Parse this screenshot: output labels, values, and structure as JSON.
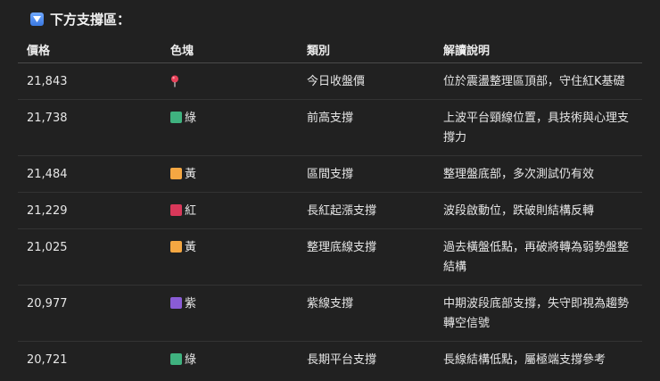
{
  "heading": {
    "icon": "down-arrow-button-icon",
    "text": "下方支撐區："
  },
  "table": {
    "headers": {
      "price": "價格",
      "color": "色塊",
      "type": "類別",
      "desc": "解讀說明"
    },
    "rows": [
      {
        "price": "21,843",
        "color_icon": "round-pushpin-icon",
        "color_label": "",
        "type": "今日收盤價",
        "desc": "位於震盪整理區頂部，守住紅K基礎"
      },
      {
        "price": "21,738",
        "color_icon": "green-square-icon",
        "swatch": "#3fb27f",
        "color_label": "綠",
        "type": "前高支撐",
        "desc": "上波平台頸線位置，具技術與心理支撐力"
      },
      {
        "price": "21,484",
        "color_icon": "yellow-square-icon",
        "swatch": "#f5a742",
        "color_label": "黃",
        "type": "區間支撐",
        "desc": "整理盤底部，多次測試仍有效"
      },
      {
        "price": "21,229",
        "color_icon": "red-square-icon",
        "swatch": "#d9385a",
        "color_label": "紅",
        "type": "長紅起漲支撐",
        "desc": "波段啟動位，跌破則結構反轉"
      },
      {
        "price": "21,025",
        "color_icon": "yellow-square-icon",
        "swatch": "#f5a742",
        "color_label": "黃",
        "type": "整理底線支撐",
        "desc": "過去橫盤低點，再破將轉為弱勢盤整結構"
      },
      {
        "price": "20,977",
        "color_icon": "purple-square-icon",
        "swatch": "#8a5cd6",
        "color_label": "紫",
        "type": "紫線支撐",
        "desc": "中期波段底部支撐，失守即視為趨勢轉空信號"
      },
      {
        "price": "20,721",
        "color_icon": "green-square-icon",
        "swatch": "#3fb27f",
        "color_label": "綠",
        "type": "長期平台支撐",
        "desc": "長線結構低點，屬極端支撐參考"
      }
    ]
  }
}
